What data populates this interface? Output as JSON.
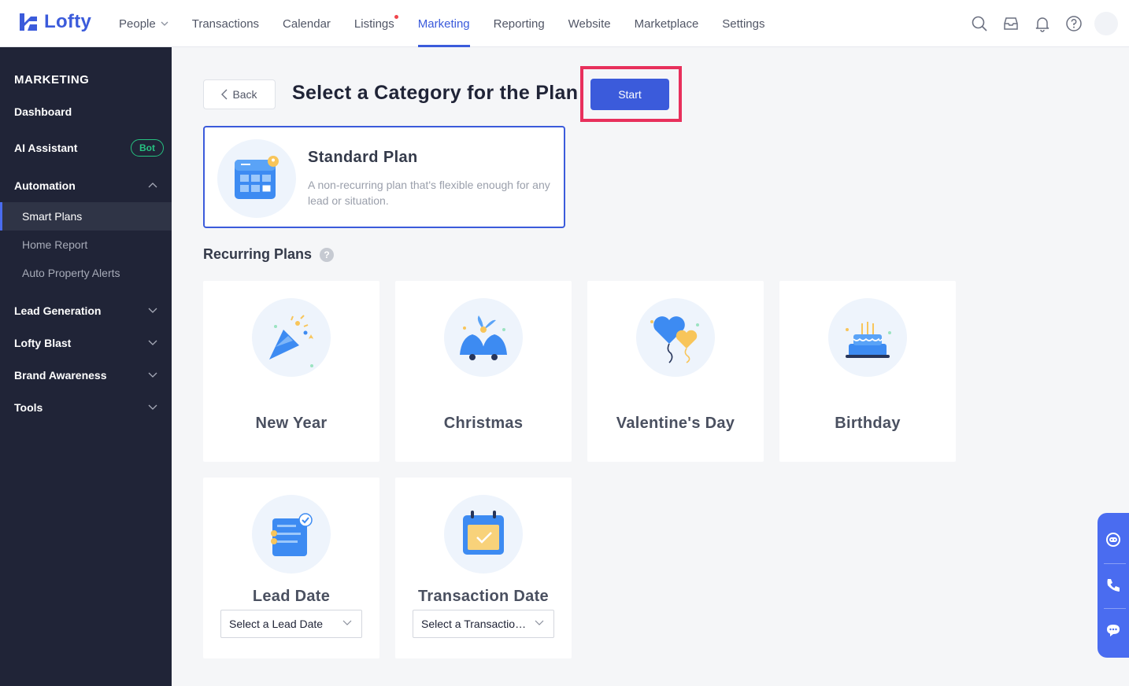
{
  "app": {
    "logo_text": "Lofty"
  },
  "nav": {
    "items": [
      {
        "label": "People"
      },
      {
        "label": "Transactions"
      },
      {
        "label": "Calendar"
      },
      {
        "label": "Listings"
      },
      {
        "label": "Marketing"
      },
      {
        "label": "Reporting"
      },
      {
        "label": "Website"
      },
      {
        "label": "Marketplace"
      },
      {
        "label": "Settings"
      }
    ],
    "active": "Marketing"
  },
  "top_icons": [
    "search-icon",
    "inbox-icon",
    "bell-icon",
    "help-icon",
    "avatar"
  ],
  "sidebar": {
    "title": "MARKETING",
    "dashboard": "Dashboard",
    "ai_assistant": "AI Assistant",
    "ai_badge": "Bot",
    "automation": "Automation",
    "automation_sub": [
      "Smart Plans",
      "Home Report",
      "Auto Property Alerts"
    ],
    "lead_generation": "Lead Generation",
    "lofty_blast": "Lofty Blast",
    "brand_awareness": "Brand Awareness",
    "tools": "Tools"
  },
  "main": {
    "back_label": "Back",
    "title": "Select a Category for the Plan",
    "start_label": "Start",
    "standard": {
      "title": "Standard Plan",
      "description": "A non-recurring plan that's flexible enough for any lead or situation."
    },
    "recurring_title": "Recurring Plans",
    "recurring_help": "?",
    "cards": [
      {
        "label": "New Year",
        "icon": "party-popper-icon"
      },
      {
        "label": "Christmas",
        "icon": "christmas-bells-icon"
      },
      {
        "label": "Valentine's Day",
        "icon": "heart-balloons-icon"
      },
      {
        "label": "Birthday",
        "icon": "birthday-cake-icon"
      },
      {
        "label": "Lead Date",
        "icon": "document-check-icon",
        "select_value": "Select a Lead Date"
      },
      {
        "label": "Transaction Date",
        "icon": "calendar-check-icon",
        "select_value": "Select a Transaction Date"
      }
    ]
  },
  "colors": {
    "accent": "#3b5bdb",
    "sidebar_bg": "#202437",
    "highlight": "#e8305c",
    "badge_green": "#26c281"
  }
}
